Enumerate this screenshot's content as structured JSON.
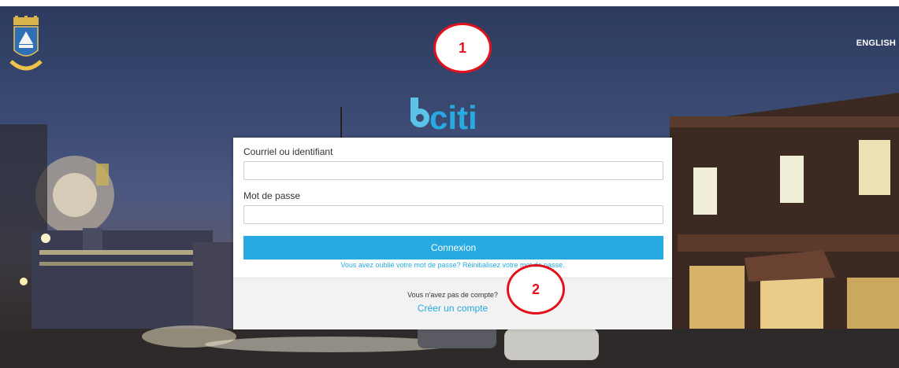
{
  "header": {
    "language_link": "ENGLISH",
    "crest_label": "Saint-Lambert"
  },
  "brand": {
    "name": "bciti",
    "color_primary": "#27aae1",
    "color_secondary": "#5bc2e8"
  },
  "annotations": [
    "1",
    "2"
  ],
  "login_form": {
    "email_label": "Courriel ou identifiant",
    "email_value": "",
    "password_label": "Mot de passe",
    "password_value": "",
    "submit_label": "Connexion",
    "forgot_password_prefix": "Vous avez oublié votre mot de passe? ",
    "forgot_password_link": "Réinitialisez votre mot de passe."
  },
  "signup": {
    "question": "Vous n'avez pas de compte?",
    "create_account_link": "Créer un compte"
  },
  "colors": {
    "accent": "#27aae1",
    "annotation": "#e3101e"
  }
}
